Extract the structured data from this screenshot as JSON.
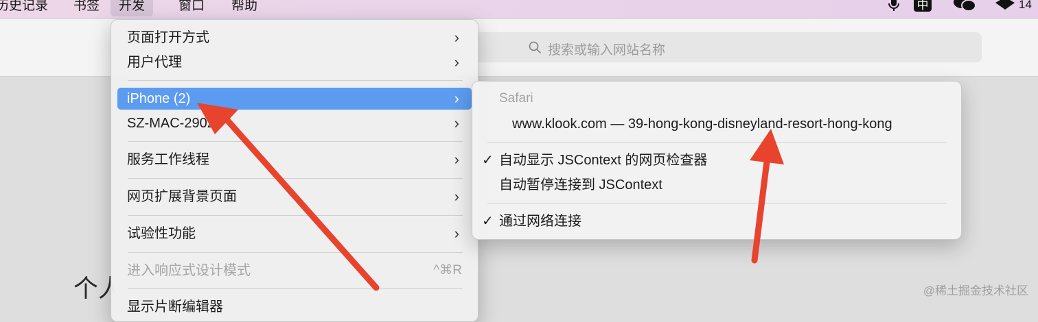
{
  "menubar": {
    "items": [
      {
        "label": "历史记录"
      },
      {
        "label": "书签"
      },
      {
        "label": "开发"
      },
      {
        "label": "窗口"
      },
      {
        "label": "帮助"
      }
    ],
    "battery_text": "14"
  },
  "toolbar": {
    "address_placeholder": "搜索或输入网站名称"
  },
  "page": {
    "title_fragment": "个人",
    "watermark": "@稀土掘金技术社区"
  },
  "develop_menu": {
    "items": [
      {
        "label": "页面打开方式"
      },
      {
        "label": "用户代理"
      },
      {
        "label": "iPhone (2)"
      },
      {
        "label": "SZ-MAC-2902"
      },
      {
        "label": "服务工作线程"
      },
      {
        "label": "网页扩展背景页面"
      },
      {
        "label": "试验性功能"
      },
      {
        "label": "进入响应式设计模式",
        "shortcut": "^⌘R"
      },
      {
        "label": "显示片断编辑器"
      }
    ]
  },
  "iphone_submenu": {
    "header": "Safari",
    "page_item": "www.klook.com — 39-hong-kong-disneyland-resort-hong-kong",
    "options": [
      {
        "label": "自动显示 JSContext 的网页检查器",
        "checked": true
      },
      {
        "label": "自动暂停连接到 JSContext",
        "checked": false
      },
      {
        "label": "通过网络连接",
        "checked": true
      }
    ],
    "checkmark": "✓"
  },
  "colors": {
    "highlight": "#5b9cf1",
    "arrow": "#e8432d"
  }
}
